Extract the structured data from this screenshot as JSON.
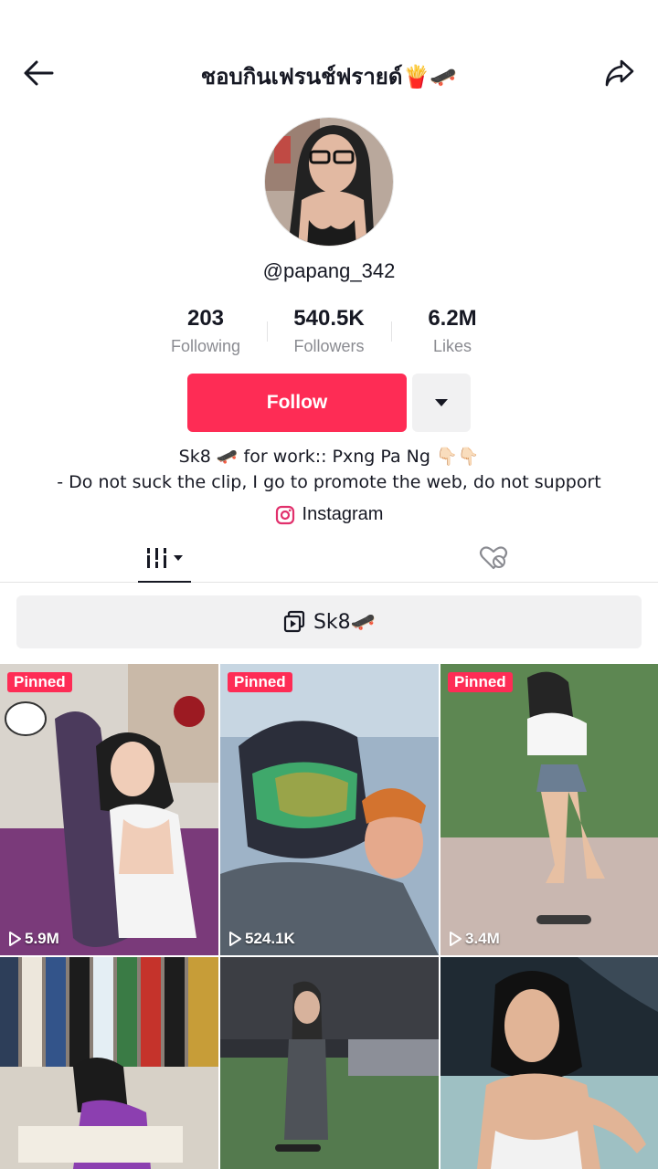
{
  "header": {
    "title": "ชอบกินเฟรนช์ฟรายด์🍟🛹"
  },
  "profile": {
    "username": "@papang_342",
    "stats": [
      {
        "value": "203",
        "label": "Following"
      },
      {
        "value": "540.5K",
        "label": "Followers"
      },
      {
        "value": "6.2M",
        "label": "Likes"
      }
    ],
    "follow_label": "Follow",
    "bio_line1": "Sk8 🛹 for work:: Pxng Pa Ng 👇🏻👇🏻",
    "bio_line2": "- Do not suck the clip, I go to promote the web, do not support",
    "link_label": "Instagram"
  },
  "playlist": {
    "label": "Sk8🛹"
  },
  "videos": [
    {
      "pinned": "Pinned",
      "views": "5.9M"
    },
    {
      "pinned": "Pinned",
      "views": "524.1K"
    },
    {
      "pinned": "Pinned",
      "views": "3.4M"
    },
    {
      "pinned": "",
      "views": ""
    },
    {
      "pinned": "",
      "views": ""
    },
    {
      "pinned": "",
      "views": ""
    }
  ],
  "colors": {
    "accent": "#fe2c55",
    "text": "#161823",
    "muted": "#8a8b91",
    "button_bg": "#f1f1f2"
  }
}
